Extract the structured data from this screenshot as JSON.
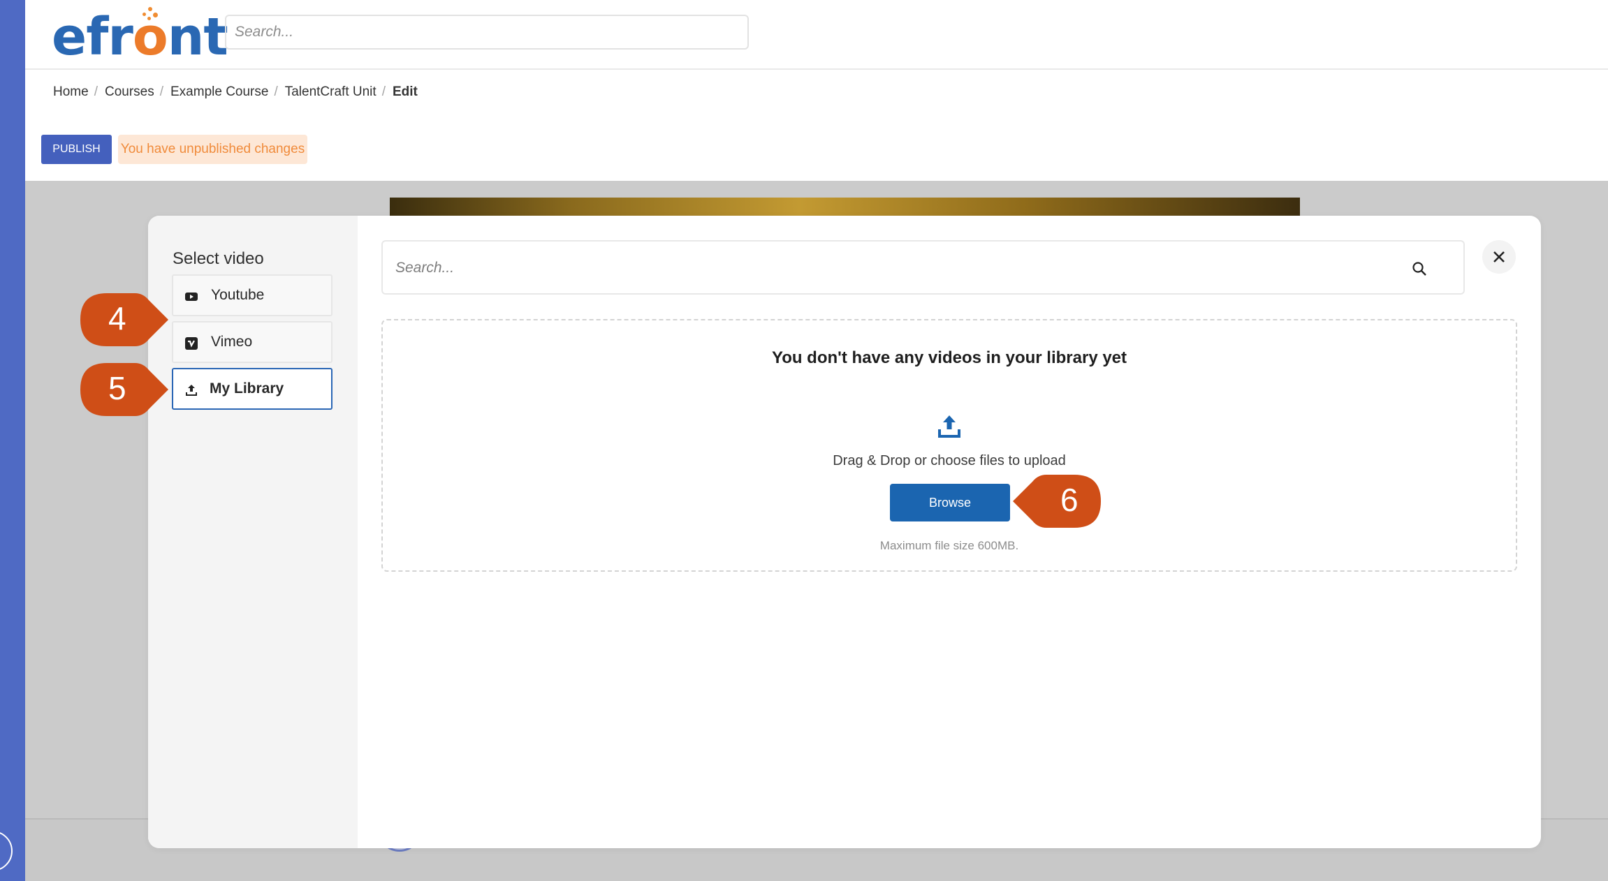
{
  "logo": {
    "text_main": "efr",
    "text_o": "o",
    "text_end": "nt"
  },
  "top_search": {
    "placeholder": "Search..."
  },
  "breadcrumb": {
    "items": [
      "Home",
      "Courses",
      "Example Course",
      "TalentCraft Unit"
    ],
    "current": "Edit",
    "separator": "/"
  },
  "toolbar": {
    "publish_label": "PUBLISH",
    "unpublished_notice": "You have unpublished changes"
  },
  "modal": {
    "side_title": "Select video",
    "sources": [
      {
        "label": "Youtube",
        "icon": "youtube-icon",
        "active": false
      },
      {
        "label": "Vimeo",
        "icon": "vimeo-icon",
        "active": false
      },
      {
        "label": "My Library",
        "icon": "upload-icon",
        "active": true
      }
    ],
    "search_placeholder": "Search...",
    "empty_title": "You don't have any videos in your library yet",
    "drag_text": "Drag & Drop or choose files to upload",
    "browse_label": "Browse",
    "max_size_text": "Maximum file size 600MB."
  },
  "callouts": [
    {
      "number": "4"
    },
    {
      "number": "5"
    },
    {
      "number": "6"
    }
  ],
  "colors": {
    "brand_blue": "#2a68b3",
    "brand_orange": "#ec7b2a",
    "publish_blue": "#4460bd",
    "callout_orange": "#cf4e17",
    "browse_blue": "#1b65b0"
  }
}
